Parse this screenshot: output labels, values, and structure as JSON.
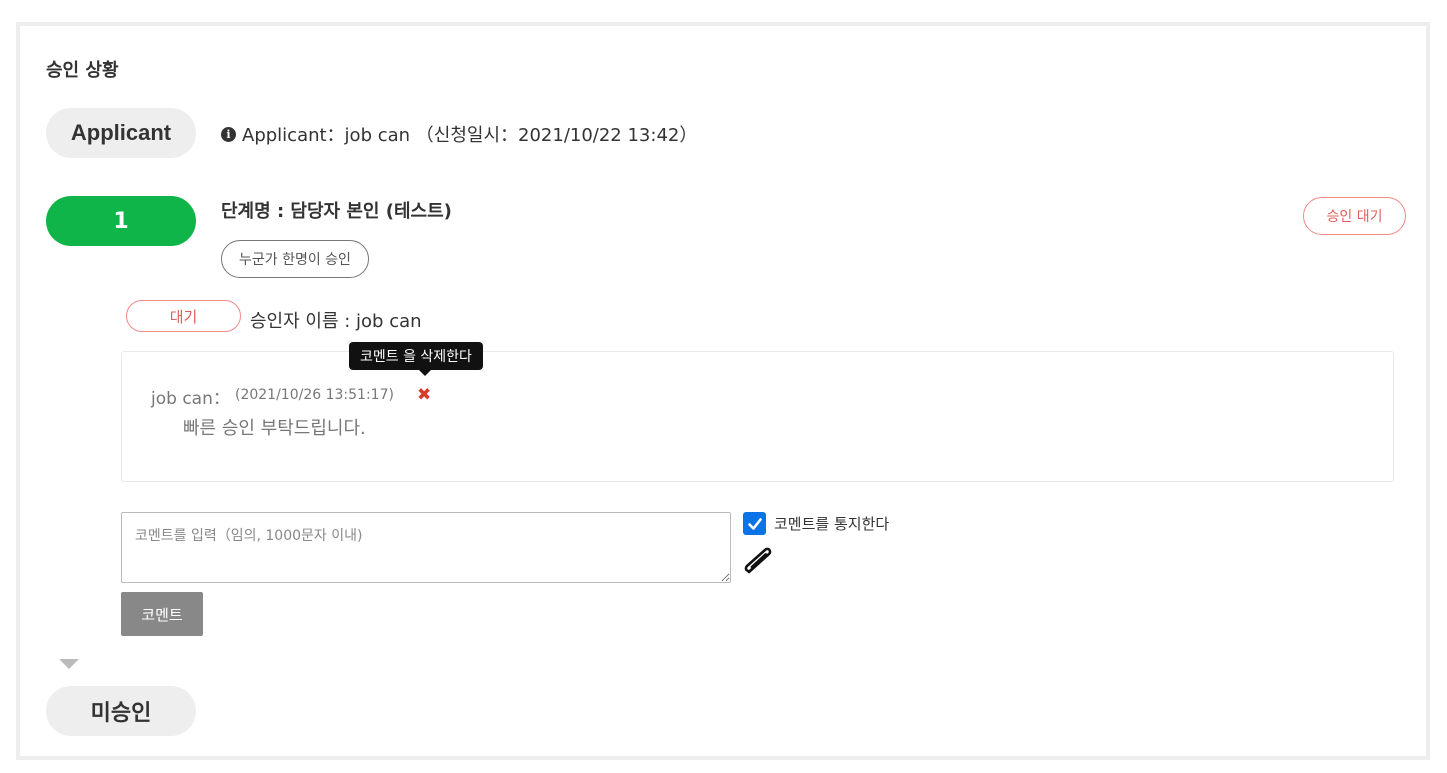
{
  "section_title": "승인 상황",
  "applicant": {
    "pill_label": "Applicant",
    "info_icon": "info-circle-icon",
    "info_text": "Applicant：job can （신청일시：2021/10/22 13:42）"
  },
  "step": {
    "number": "1",
    "name": "단계명 : 담당자 본인 (테스트)",
    "approval_type": "누군가 한명이 승인",
    "status": "승인 대기"
  },
  "approver": {
    "status": "대기",
    "name": "승인자 이름 : job can"
  },
  "comment": {
    "tooltip": "코멘트 을 삭제한다",
    "author": "job can：",
    "timestamp": "(2021/10/26 13:51:17)",
    "delete_icon": "close-x-icon",
    "text": "빠른 승인 부탁드립니다."
  },
  "comment_form": {
    "placeholder": "코멘트를 입력（임의, 1000문자 이내)",
    "notify_checked": true,
    "notify_label": "코멘트를 통지한다",
    "attach_icon": "paperclip-icon",
    "submit_label": "코멘트"
  },
  "next_step": {
    "pill_label": "미승인"
  },
  "colors": {
    "step_green": "#10b54a",
    "wait_red": "#e0605a",
    "checkbox_blue": "#0b72e7",
    "delete_red": "#d93b2b"
  }
}
